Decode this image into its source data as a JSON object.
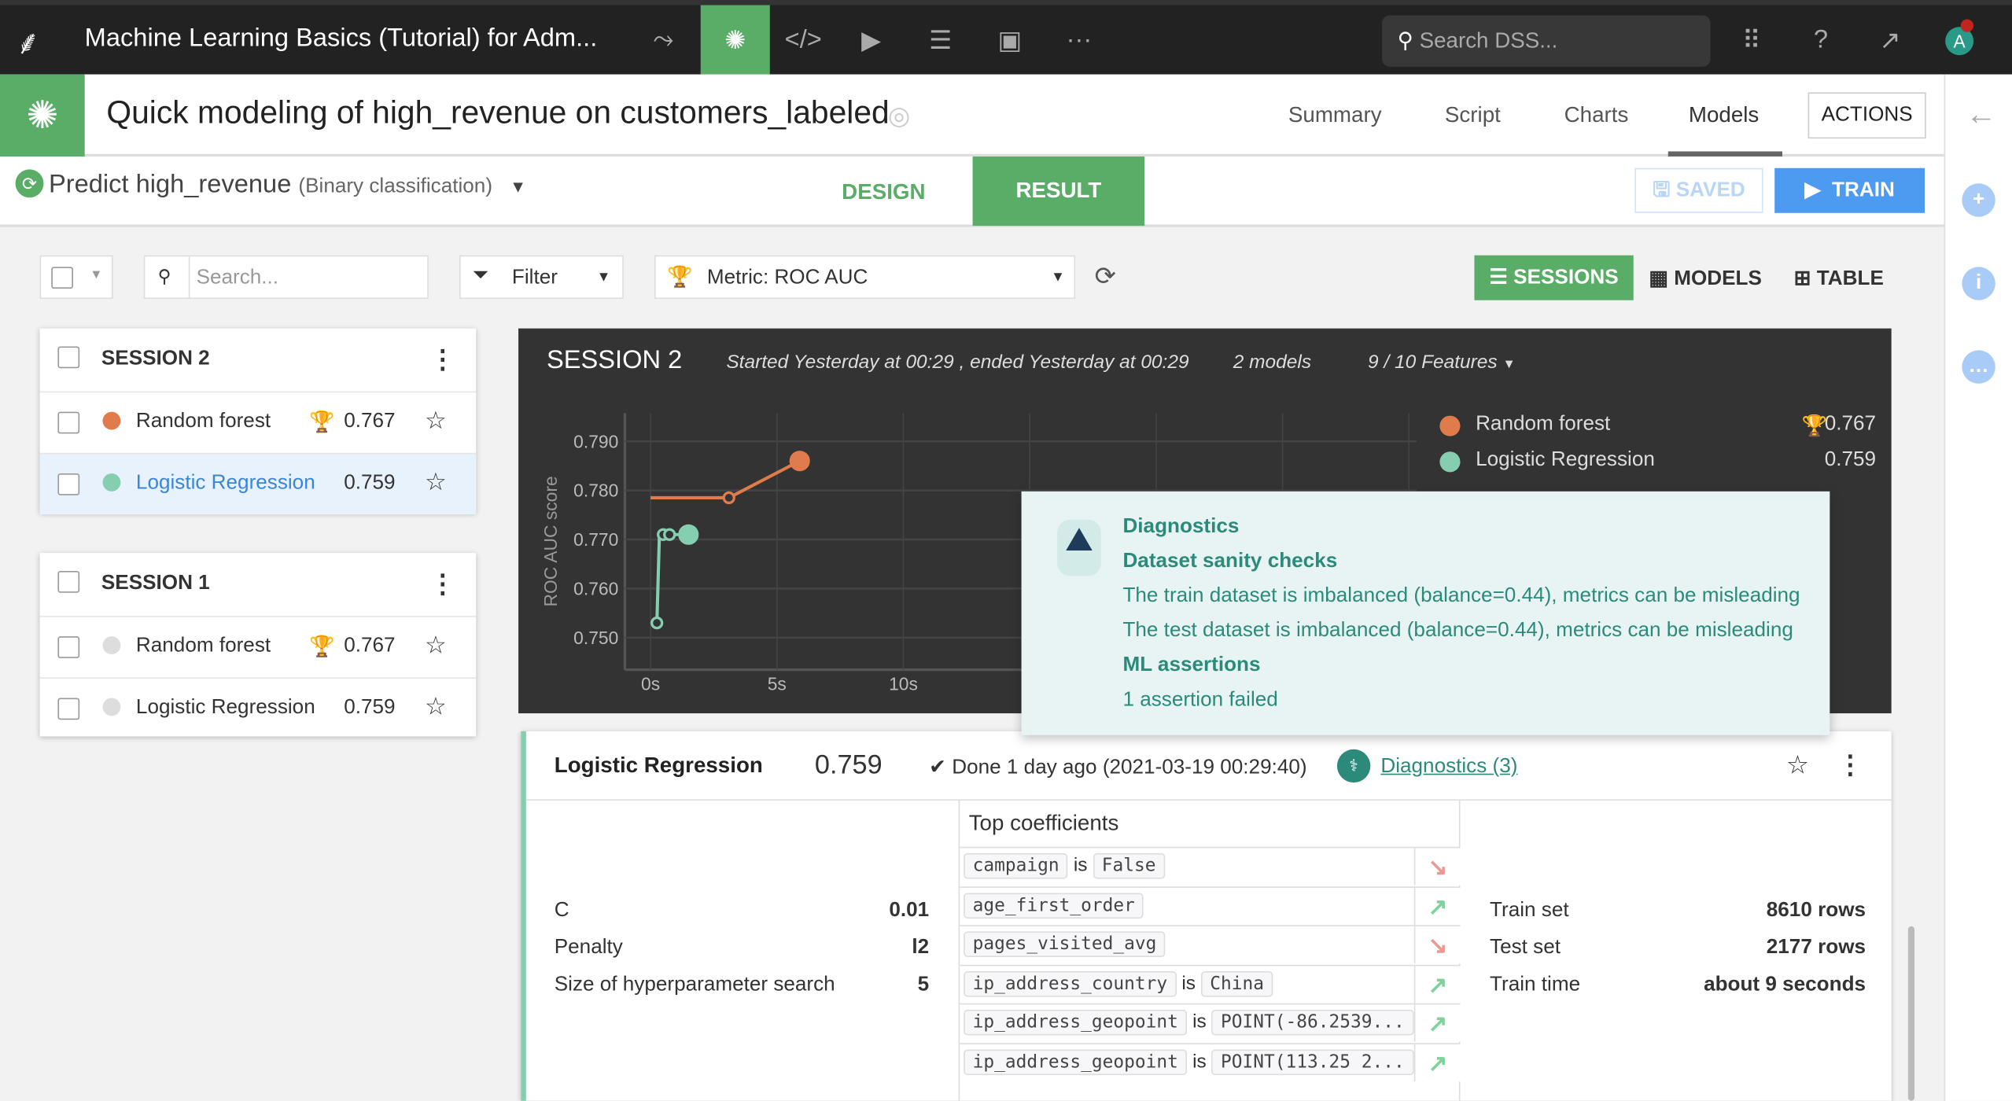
{
  "topbar": {
    "title": "Machine Learning Basics (Tutorial) for Adm...",
    "search_placeholder": "Search DSS...",
    "avatar": "A",
    "icons": [
      "bird-logo",
      "flow-icon",
      "ml-icon",
      "code-icon",
      "run-icon",
      "datasets-icon",
      "dashboard-icon",
      "more-icon",
      "grid-icon",
      "help-icon",
      "activity-icon"
    ]
  },
  "header": {
    "title": "Quick modeling of high_revenue on customers_labeled",
    "tabs": [
      "Summary",
      "Script",
      "Charts",
      "Models"
    ],
    "active_tab": "Models",
    "actions": "ACTIONS"
  },
  "subheader": {
    "task": "Predict high_revenue",
    "task_type": "(Binary classification)",
    "design": "DESIGN",
    "result": "RESULT",
    "saved": "SAVED",
    "train": "TRAIN"
  },
  "toolbar": {
    "search_placeholder": "Search...",
    "filter": "Filter",
    "metric": "Metric: ROC AUC",
    "views": [
      "SESSIONS",
      "MODELS",
      "TABLE"
    ]
  },
  "sessions": [
    {
      "name": "SESSION 2",
      "models": [
        {
          "name": "Random forest",
          "score": "0.767",
          "best": true,
          "color": "#e07b4b"
        },
        {
          "name": "Logistic Regression",
          "score": "0.759",
          "best": false,
          "color": "#86ceb0",
          "selected": true
        }
      ]
    },
    {
      "name": "SESSION 1",
      "models": [
        {
          "name": "Random forest",
          "score": "0.767",
          "best": true,
          "color": "#ddd"
        },
        {
          "name": "Logistic Regression",
          "score": "0.759",
          "best": false,
          "color": "#ddd"
        }
      ]
    }
  ],
  "session_panel": {
    "title": "SESSION 2",
    "times": "Started Yesterday at 00:29 , ended Yesterday at 00:29",
    "models": "2 models",
    "features": "9 / 10 Features"
  },
  "chart_data": {
    "type": "line",
    "ylabel": "ROC AUC score",
    "ylim": [
      0.745,
      0.793
    ],
    "yticks": [
      "0.790",
      "0.780",
      "0.770",
      "0.760",
      "0.750"
    ],
    "xticks": [
      "0s",
      "5s",
      "10s"
    ],
    "xlim": [
      0,
      30
    ],
    "series": [
      {
        "name": "Random forest",
        "color": "#e07b4b",
        "score": "0.767",
        "x": [
          0,
          3.1,
          5.9
        ],
        "y": [
          0.7785,
          0.7785,
          0.786
        ],
        "markers": [
          false,
          true,
          true
        ]
      },
      {
        "name": "Logistic Regression",
        "color": "#86ceb0",
        "score": "0.759",
        "x": [
          0.25,
          0.35,
          0.5,
          0.75,
          1.5
        ],
        "y": [
          0.753,
          0.771,
          0.771,
          0.771,
          0.771
        ],
        "markers": [
          true,
          false,
          true,
          true,
          true
        ]
      }
    ]
  },
  "diagnostics_popup": {
    "title": "Diagnostics",
    "section1": "Dataset sanity checks",
    "lines": [
      "The train dataset is imbalanced (balance=0.44), metrics can be misleading",
      "The test dataset is imbalanced (balance=0.44), metrics can be misleading"
    ],
    "section2": "ML assertions",
    "assertion": "1 assertion failed"
  },
  "model": {
    "name": "Logistic Regression",
    "score": "0.759",
    "status": "Done 1 day ago (2021-03-19 00:29:40)",
    "diagnostics": "Diagnostics (3)",
    "params": [
      {
        "k": "C",
        "v": "0.01"
      },
      {
        "k": "Penalty",
        "v": "l2"
      },
      {
        "k": "Size of hyperparameter search",
        "v": "5"
      }
    ],
    "coef_title": "Top coefficients",
    "coefs": [
      {
        "f": "campaign",
        "is": "is",
        "v": "False",
        "dir": "down"
      },
      {
        "f": "age_first_order",
        "dir": "up"
      },
      {
        "f": "pages_visited_avg",
        "dir": "down"
      },
      {
        "f": "ip_address_country",
        "is": "is",
        "v": "China",
        "dir": "up"
      },
      {
        "f": "ip_address_geopoint",
        "is": "is",
        "v": "POINT(-86.2539...",
        "dir": "up"
      },
      {
        "f": "ip_address_geopoint",
        "is": "is",
        "v": "POINT(113.25 2...",
        "dir": "up"
      }
    ],
    "stats": [
      {
        "k": "Train set",
        "v": "8610 rows"
      },
      {
        "k": "Test set",
        "v": "2177 rows"
      },
      {
        "k": "Train time",
        "v": "about 9 seconds"
      }
    ]
  },
  "colors": {
    "green": "#5aad67",
    "blue": "#4d9bf0",
    "teal": "#2b8a7a"
  }
}
